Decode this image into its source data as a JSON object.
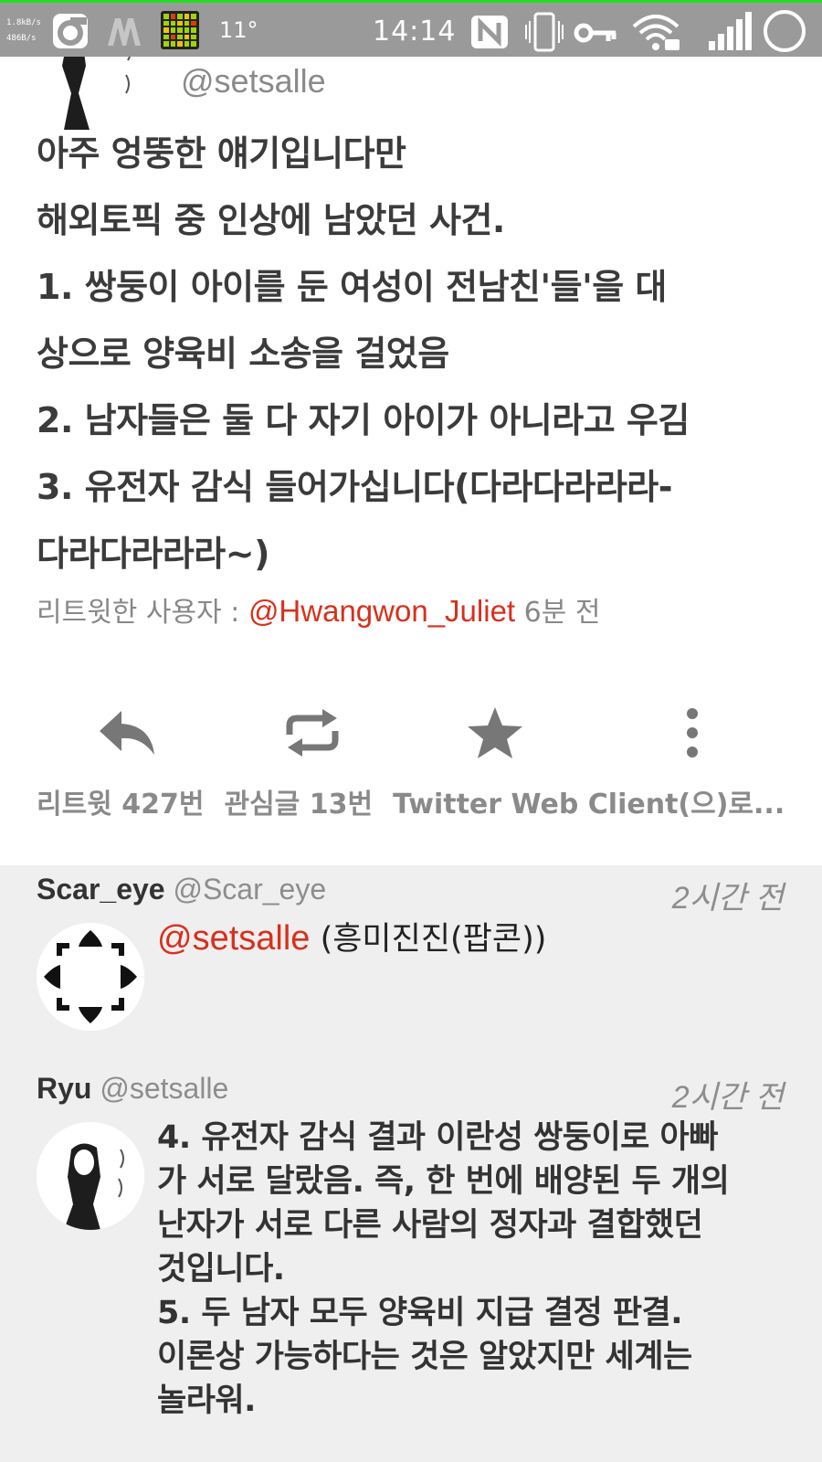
{
  "status_bar": {
    "net_up": "1.8kB/s",
    "net_down": "486B/s",
    "temperature": "11°",
    "time": "14:14"
  },
  "main_tweet": {
    "handle": "@setsalle",
    "lines": [
      "아주 엉뚱한 얘기입니다만",
      "해외토픽 중 인상에 남았던 사건.",
      "1. 쌍둥이 아이를 둔 여성이 전남친'들'을 대",
      "상으로 양육비 소송을 걸었음",
      "2. 남자들은 둘 다 자기 아이가 아니라고 우김",
      "3. 유전자 감식 들어가십니다(다라다라라라-",
      "다라다라라라~)"
    ],
    "retweeted_by_label": "리트윗한 사용자 :",
    "retweeted_by": "@Hwangwon_Juliet",
    "retweeted_ago": "6분 전",
    "stats": {
      "retweets": "리트윗 427번",
      "favorites": "관심글 13번",
      "client": "Twitter Web Client(으)로..."
    }
  },
  "replies": [
    {
      "name": "Scar_eye",
      "handle": "@Scar_eye",
      "time": "2시간 전",
      "mention": "@setsalle",
      "text": "(흥미진진(팝콘))"
    },
    {
      "name": "Ryu",
      "handle": "@setsalle",
      "time": "2시간 전",
      "lines": [
        "4. 유전자 감식 결과 이란성 쌍둥이로 아빠",
        "가 서로 달랐음. 즉, 한 번에 배양된 두 개의",
        "난자가 서로 다른 사람의 정자과 결합했던",
        "것입니다.",
        "5. 두 남자 모두 양육비 지급 결정 판결.",
        "이론상 가능하다는 것은 알았지만 세계는",
        "놀라워."
      ]
    }
  ],
  "colors": {
    "accent": "#d8301c",
    "status_bar": "#9a9a9a",
    "reply_bg": "#efefef"
  }
}
